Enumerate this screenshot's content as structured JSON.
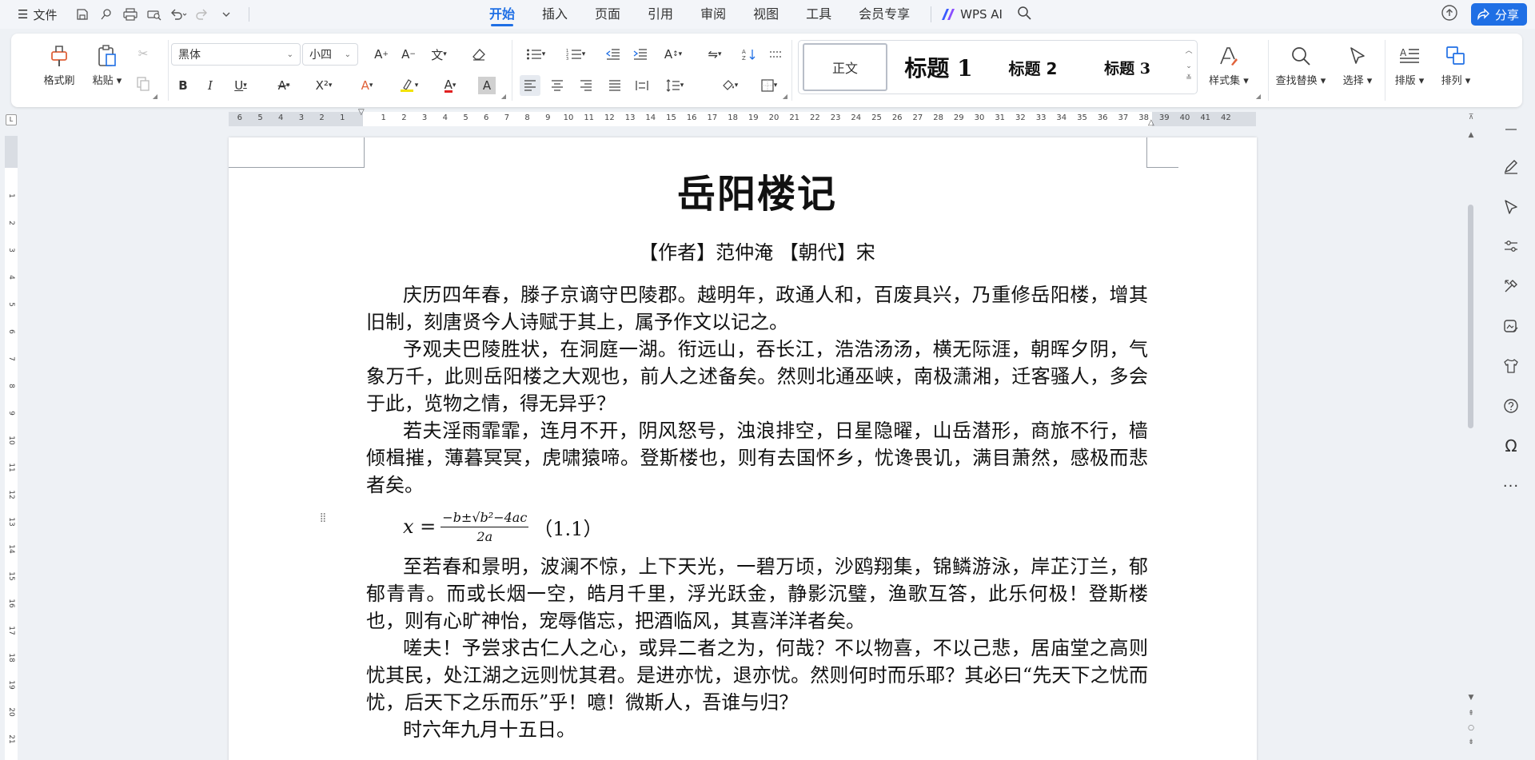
{
  "topbar": {
    "file_label": "文件",
    "tabs": [
      "开始",
      "插入",
      "页面",
      "引用",
      "审阅",
      "视图",
      "工具",
      "会员专享"
    ],
    "active_tab": "开始",
    "wps_ai_label": "WPS AI",
    "share_label": "分享",
    "accent_color": "#1f6fe5"
  },
  "ribbon": {
    "format_painter_label": "格式刷",
    "paste_label": "粘贴",
    "font_name": "黑体",
    "font_size": "小四",
    "styles": {
      "normal": "正文",
      "heading1": "标题 1",
      "heading2": "标题 2",
      "heading3": "标题 3"
    },
    "style_set_label": "样式集",
    "find_replace_label": "查找替换",
    "select_label": "选择",
    "layout_label": "排版",
    "arrange_label": "排列"
  },
  "ruler": {
    "h_left": [
      "6",
      "5",
      "4",
      "3",
      "2",
      "1"
    ],
    "h_main": [
      "1",
      "2",
      "3",
      "4",
      "5",
      "6",
      "7",
      "8",
      "9",
      "10",
      "11",
      "12",
      "13",
      "14",
      "15",
      "16",
      "17",
      "18",
      "19",
      "20",
      "21",
      "22",
      "23",
      "24",
      "25",
      "26",
      "27",
      "28",
      "29",
      "30",
      "31",
      "32",
      "33",
      "34",
      "35",
      "36",
      "37"
    ],
    "h_right": [
      "38",
      "39",
      "40",
      "41",
      "42"
    ],
    "v_numbers": [
      "1",
      "2",
      "3",
      "4",
      "5",
      "6",
      "7",
      "8",
      "9",
      "10",
      "11",
      "12",
      "13",
      "14",
      "15",
      "16",
      "17",
      "18",
      "19",
      "20",
      "21"
    ]
  },
  "document": {
    "title": "岳阳楼记",
    "meta": "【作者】范仲淹 【朝代】宋",
    "paragraphs_before": [
      "庆历四年春，滕子京谪守巴陵郡。越明年，政通人和，百废具兴，乃重修岳阳楼，增其旧制，刻唐贤今人诗赋于其上，属予作文以记之。",
      "予观夫巴陵胜状，在洞庭一湖。衔远山，吞长江，浩浩汤汤，横无际涯，朝晖夕阴，气象万千，此则岳阳楼之大观也，前人之述备矣。然则北通巫峡，南极潇湘，迁客骚人，多会于此，览物之情，得无异乎？",
      "若夫淫雨霏霏，连月不开，阴风怒号，浊浪排空，日星隐曜，山岳潜形，商旅不行，樯倾楫摧，薄暮冥冥，虎啸猿啼。登斯楼也，则有去国怀乡，忧谗畏讥，满目萧然，感极而悲者矣。"
    ],
    "formula": {
      "lhs": "x =",
      "numerator": "−b±√b²−4ac",
      "denominator": "2a",
      "number": "（1.1）"
    },
    "paragraphs_after": [
      "至若春和景明，波澜不惊，上下天光，一碧万顷，沙鸥翔集，锦鳞游泳，岸芷汀兰，郁郁青青。而或长烟一空，皓月千里，浮光跃金，静影沉璧，渔歌互答，此乐何极！登斯楼也，则有心旷神怡，宠辱偕忘，把酒临风，其喜洋洋者矣。",
      "嗟夫！予尝求古仁人之心，或异二者之为，何哉？不以物喜，不以己悲，居庙堂之高则忧其民，处江湖之远则忧其君。是进亦忧，退亦忧。然则何时而乐耶？其必曰“先天下之忧而忧，后天下之乐而乐”乎！噫！微斯人，吾谁与归？",
      "时六年九月十五日。"
    ]
  }
}
